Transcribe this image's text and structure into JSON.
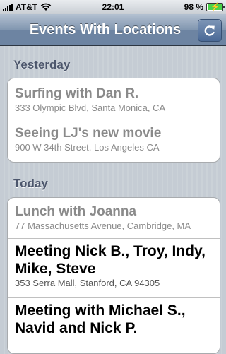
{
  "status_bar": {
    "carrier": "AT&T",
    "time": "22:01",
    "battery": "98 %"
  },
  "navbar": {
    "title": "Events With Locations",
    "refresh_icon": "refresh-icon"
  },
  "sections": [
    {
      "header": "Yesterday",
      "events": [
        {
          "title": "Surfing with Dan R.",
          "location": "333 Olympic Blvd, Santa Monica, CA"
        },
        {
          "title": "Seeing LJ's new movie",
          "location": "900 W 34th Street, Los Angeles CA"
        }
      ]
    },
    {
      "header": "Today",
      "events": [
        {
          "title": "Lunch with Joanna",
          "location": "77 Massachusetts Avenue, Cambridge, MA"
        },
        {
          "title": "Meeting Nick B., Troy, Indy, Mike, Steve",
          "location": "353 Serra Mall, Stanford, CA 94305"
        },
        {
          "title": "Meeting with Michael S., Navid and Nick P.",
          "location": ""
        }
      ]
    }
  ]
}
